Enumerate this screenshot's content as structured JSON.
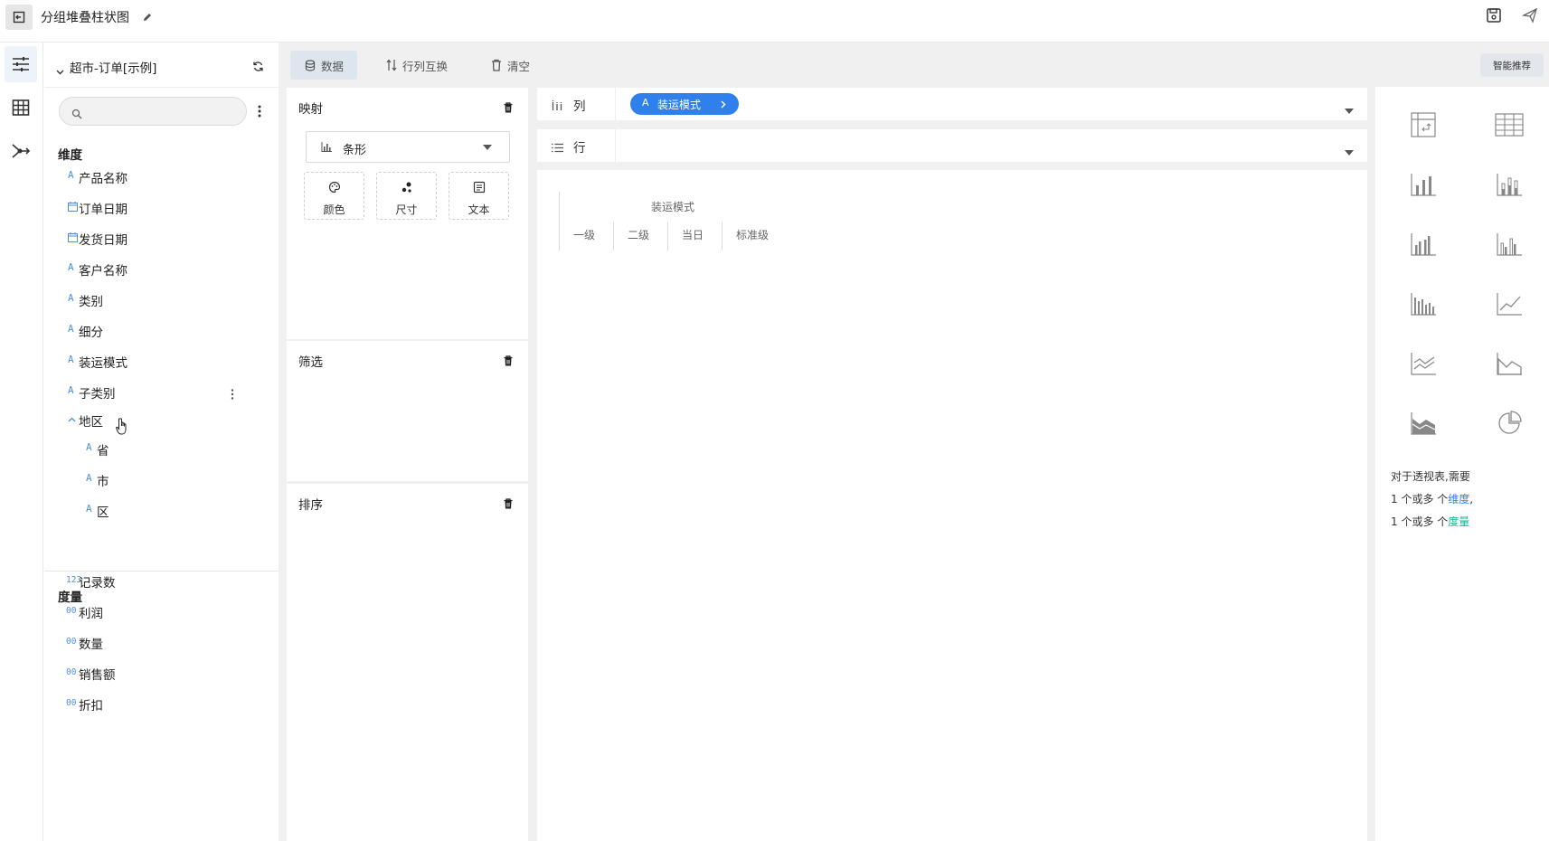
{
  "header": {
    "title": "分组堆叠柱状图"
  },
  "datasource": {
    "name": "超市-订单[示例]"
  },
  "search": {
    "placeholder": ""
  },
  "dimensions": {
    "title": "维度",
    "items": [
      {
        "icon": "A",
        "label": "产品名称"
      },
      {
        "icon": "calendar",
        "label": "订单日期"
      },
      {
        "icon": "calendar",
        "label": "发货日期"
      },
      {
        "icon": "A",
        "label": "客户名称"
      },
      {
        "icon": "A",
        "label": "类别"
      },
      {
        "icon": "A",
        "label": "细分"
      },
      {
        "icon": "A",
        "label": "装运模式"
      },
      {
        "icon": "A",
        "label": "子类别"
      },
      {
        "icon": "chevron-up",
        "label": "地区"
      },
      {
        "icon": "A",
        "label": "省"
      },
      {
        "icon": "A",
        "label": "市"
      },
      {
        "icon": "A",
        "label": "区"
      }
    ]
  },
  "measures": {
    "title": "度量",
    "items": [
      {
        "icon": "123",
        "label": "记录数"
      },
      {
        "icon": "00",
        "label": "利润"
      },
      {
        "icon": "00",
        "label": "数量"
      },
      {
        "icon": "00",
        "label": "销售额"
      },
      {
        "icon": "00",
        "label": "折扣"
      }
    ]
  },
  "toolbar": {
    "data": "数据",
    "swap": "行列互换",
    "clear": "清空",
    "smart": "智能推荐"
  },
  "mapping": {
    "title": "映射",
    "chart_type": "条形",
    "color": "颜色",
    "size": "尺寸",
    "text": "文本"
  },
  "filter": {
    "title": "筛选"
  },
  "sort": {
    "title": "排序"
  },
  "shelves": {
    "column_label": "列",
    "row_label": "行",
    "column_pill_icon": "A",
    "column_pill": "装运模式"
  },
  "pivot": {
    "header": "装运模式",
    "columns": [
      "一级",
      "二级",
      "当日",
      "标准级"
    ]
  },
  "hint": {
    "line1": "对于透视表,需要",
    "line2_pre": "1 个或多 个",
    "line2_dim": "维度",
    "line2_post": ",",
    "line3_pre": "1 个或多 个",
    "line3_mea": "度量"
  },
  "colors": {
    "accent": "#2f80ed",
    "measure": "#19b394"
  }
}
